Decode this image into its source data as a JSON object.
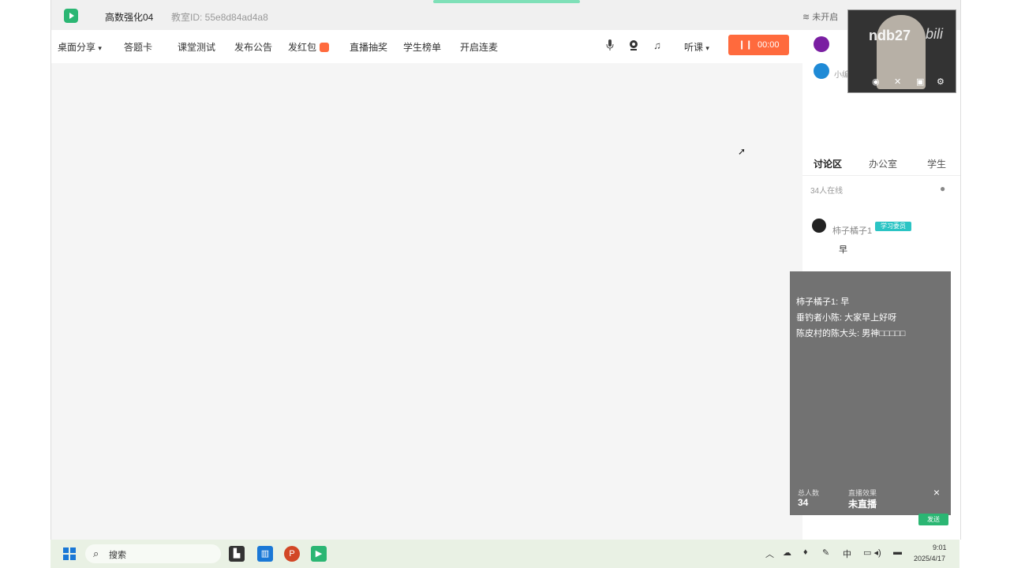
{
  "title_bar": {
    "room_name": "高数强化04",
    "room_id": "教室ID: 55e8d84ad4a8",
    "network_status": "未开启"
  },
  "toolbar": {
    "items": [
      "桌面分享",
      "答题卡",
      "课堂测试",
      "发布公告",
      "发红包",
      "直播抽奖",
      "学生榜单",
      "开启连麦"
    ],
    "desktop_share_caret": "▾",
    "listen_label": "听课",
    "live_button": "00:00",
    "live_pause_icon": "pause-icon"
  },
  "members": [
    {
      "initial": "",
      "color": "#7a1fa2"
    },
    {
      "label": "小编",
      "color": "#1f8ad6"
    }
  ],
  "webcam": {
    "watermark_text": "ndb27",
    "watermark_brand": "bili"
  },
  "tabs": [
    "讨论区",
    "办公室",
    "学生"
  ],
  "discussion": {
    "online_count": "34人在线",
    "message": {
      "name": "柿子橘子1",
      "tag": "学习委员",
      "body": "早"
    }
  },
  "overlay": {
    "messages": [
      {
        "user": "柿子橘子1",
        "text": "早"
      },
      {
        "user": "垂钓者小陈",
        "text": "大家早上好呀"
      },
      {
        "user": "陈皮村的陈大头",
        "text": "男神□□□□□"
      }
    ],
    "stat1_label": "总人数",
    "stat1_value": "34",
    "stat2_label": "直播效果",
    "stat2_value": "未直播",
    "close": "×"
  },
  "send_button": "发送",
  "taskbar": {
    "search_placeholder": "搜索",
    "time": "9:01",
    "date": "2025/4/17",
    "ime": "中"
  }
}
